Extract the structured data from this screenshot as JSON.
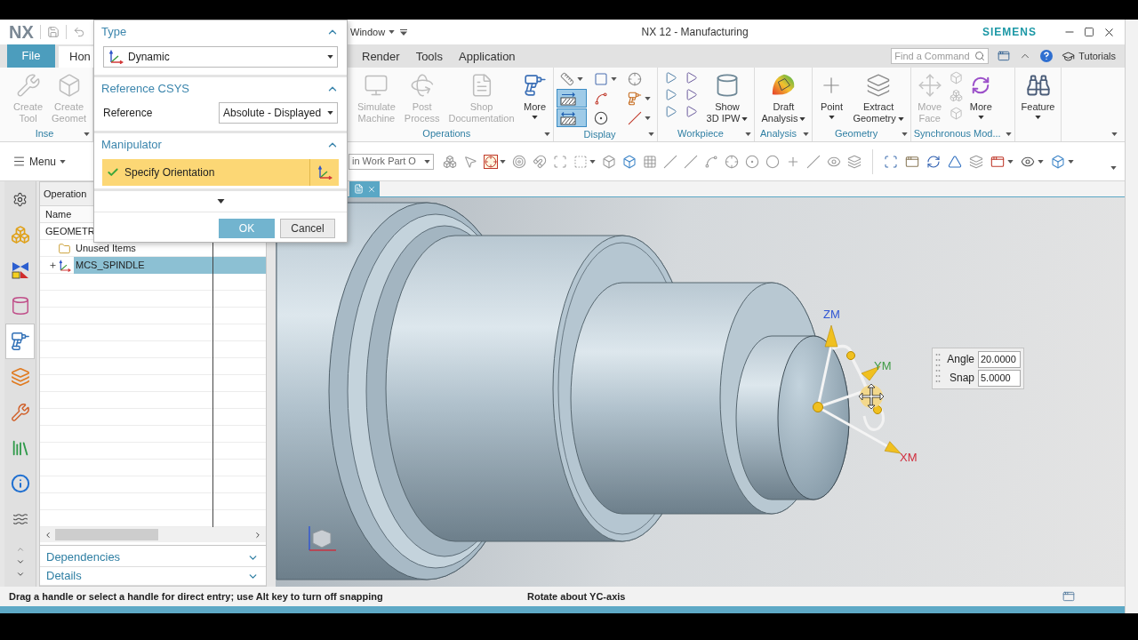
{
  "title_bar": {
    "logo": "NX",
    "menu": "Window",
    "title": "NX 12 - Manufacturing",
    "brand": "SIEMENS"
  },
  "ribbon_tabs": [
    {
      "label": "File",
      "kind": "file",
      "selected": false
    },
    {
      "label": "Hon",
      "kind": "tab",
      "selected": true
    },
    {
      "label": "Render",
      "kind": "tab",
      "selected": false
    },
    {
      "label": "Tools",
      "kind": "tab",
      "selected": false
    },
    {
      "label": "Application",
      "kind": "tab",
      "selected": false
    }
  ],
  "command_finder": {
    "placeholder": "Find a Command"
  },
  "tutorials": "Tutorials",
  "ribbon_groups": [
    {
      "label": "Inse",
      "commands": [
        {
          "kind": "large",
          "label": "Create\nTool",
          "disabled": true,
          "dropdown": false
        },
        {
          "kind": "large",
          "label": "Create\nGeomet",
          "disabled": true,
          "dropdown": false
        }
      ]
    },
    {
      "label": "Operations",
      "commands": [
        {
          "kind": "large",
          "label": "Simulate\nMachine",
          "disabled": true,
          "dropdown": false
        },
        {
          "kind": "large",
          "label": "Post\nProcess",
          "disabled": true,
          "dropdown": false
        },
        {
          "kind": "large",
          "label": "Shop\nDocumentation",
          "disabled": true,
          "dropdown": false
        },
        {
          "kind": "large",
          "label": "More",
          "disabled": false,
          "dropdown": true
        }
      ]
    },
    {
      "label": "Display",
      "commands": [
        {
          "kind": "toggles",
          "tools": [
            {
              "on": false
            },
            {
              "on": false
            },
            {
              "on": false
            },
            {
              "on": true
            },
            {
              "on": false
            },
            {
              "on": false
            },
            {
              "on": true
            },
            {
              "on": false
            },
            {
              "on": false
            }
          ]
        }
      ]
    },
    {
      "label": "Workpiece",
      "commands": [
        {
          "kind": "flags"
        },
        {
          "kind": "large",
          "label": "Show\n3D IPW",
          "disabled": false,
          "dropdown": true
        }
      ]
    },
    {
      "label": "Analysis",
      "commands": [
        {
          "kind": "large",
          "label": "Draft\nAnalysis",
          "disabled": false,
          "dropdown": true
        }
      ]
    },
    {
      "label": "Geometry",
      "commands": [
        {
          "kind": "large",
          "label": "Point",
          "disabled": false,
          "dropdown": true
        },
        {
          "kind": "large",
          "label": "Extract\nGeometry",
          "disabled": false,
          "dropdown": true
        }
      ]
    },
    {
      "label": "Synchronous Mod...",
      "commands": [
        {
          "kind": "large",
          "label": "Move\nFace",
          "disabled": true,
          "dropdown": false
        },
        {
          "kind": "stack"
        },
        {
          "kind": "large",
          "label": "More",
          "disabled": false,
          "dropdown": true
        }
      ]
    },
    {
      "commands": [
        {
          "kind": "large",
          "label": "Feature",
          "disabled": false,
          "dropdown": true
        }
      ]
    }
  ],
  "toolbar": {
    "menu": "Menu",
    "scope_filter": "in Work Part O"
  },
  "dialog": {
    "sections": [
      {
        "title": "Type",
        "expanded": true,
        "rows": [
          {
            "kind": "select",
            "value": "Dynamic"
          }
        ]
      },
      {
        "title": "Reference CSYS",
        "expanded": true,
        "rows": [
          {
            "kind": "labeled_select",
            "label": "Reference",
            "value": "Absolute - Displayed"
          }
        ]
      },
      {
        "title": "Manipulator",
        "expanded": true,
        "rows": [
          {
            "kind": "selection",
            "label": "Specify Orientation",
            "done": true,
            "active": true
          }
        ]
      }
    ],
    "buttons": [
      {
        "label": "OK",
        "kind": "primary"
      },
      {
        "label": "Cancel",
        "kind": "secondary"
      }
    ]
  },
  "resource_bar": [
    {
      "kind": "gear",
      "selected": false
    },
    {
      "kind": "cubes",
      "selected": false
    },
    {
      "kind": "shapes",
      "selected": false
    },
    {
      "kind": "drum",
      "selected": false
    },
    {
      "kind": "program",
      "selected": true
    },
    {
      "kind": "layers",
      "selected": false
    },
    {
      "kind": "machine",
      "selected": false
    },
    {
      "kind": "books",
      "selected": false
    },
    {
      "kind": "info",
      "selected": false
    },
    {
      "kind": "wave",
      "selected": false
    }
  ],
  "navigator": {
    "title": "Operation",
    "column": "Name",
    "tree": [
      {
        "label": "GEOMETR",
        "selected": false,
        "children": [
          {
            "label": "Unused Items",
            "kind": "folder",
            "selected": false
          },
          {
            "label": "MCS_SPINDLE",
            "kind": "csys",
            "selected": true,
            "expanded": false
          }
        ]
      }
    ]
  },
  "navigator_panels": [
    {
      "title": "Dependencies",
      "expanded": false
    },
    {
      "title": "Details",
      "expanded": false
    }
  ],
  "manipulator": {
    "axes": [
      {
        "label": "ZM",
        "color": "#2f55d4"
      },
      {
        "label": "YM",
        "color": "#3f9b45"
      },
      {
        "label": "XM",
        "color": "#d02c3c"
      }
    ]
  },
  "angle_snap": [
    {
      "label": "Angle",
      "value": "20.0000"
    },
    {
      "label": "Snap",
      "value": "5.0000"
    }
  ],
  "status_bar": {
    "prompt": "Drag a handle or select a handle for direct entry; use Alt key to turn off snapping",
    "status": "Rotate about YC-axis"
  }
}
